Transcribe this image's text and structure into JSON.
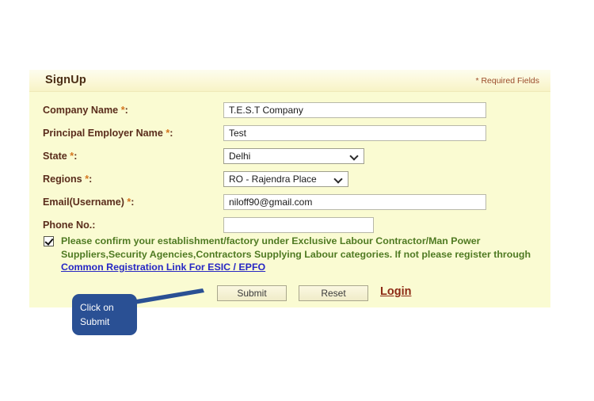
{
  "panel": {
    "title": "SignUp",
    "required_note": "* Required Fields",
    "accent_bg": "#fafbd2",
    "label_color": "#5a2d1c",
    "star_color": "#d4761f"
  },
  "fields": [
    {
      "name": "company-name",
      "label": "Company Name",
      "required": true,
      "type": "text",
      "value": "T.E.S.T Company",
      "placeholder": ""
    },
    {
      "name": "principal-employer-name",
      "label": "Principal Employer Name",
      "required": true,
      "type": "text",
      "value": "Test",
      "placeholder": ""
    },
    {
      "name": "state",
      "label": "State",
      "required": true,
      "type": "select",
      "value": "Delhi",
      "placeholder": ""
    },
    {
      "name": "regions",
      "label": "Regions",
      "required": true,
      "type": "select",
      "value": "RO - Rajendra Place",
      "placeholder": ""
    },
    {
      "name": "email-username",
      "label": "Email(Username)",
      "required": true,
      "type": "text",
      "value": "niloff90@gmail.com",
      "placeholder": ""
    },
    {
      "name": "phone-no",
      "label": "Phone No.",
      "required": false,
      "type": "text",
      "value": "",
      "placeholder": ""
    }
  ],
  "consent": {
    "checked": true,
    "text_part_1": "Please confirm your establishment/factory under Exclusive Labour Contractor/Man Power Suppliers,Security Agencies,Contractors Supplying Labour categories. If not please register through ",
    "link_label": "Common Registration Link For ESIC / EPFO",
    "text_color": "#4f7a22",
    "link_color": "#2727c4"
  },
  "actions": {
    "submit_label": "Submit",
    "reset_label": "Reset",
    "login_label": "Login",
    "login_color": "#8d2a15"
  },
  "callout": {
    "line_1": "Click on",
    "line_2": "Submit",
    "color": "#2a5094"
  }
}
